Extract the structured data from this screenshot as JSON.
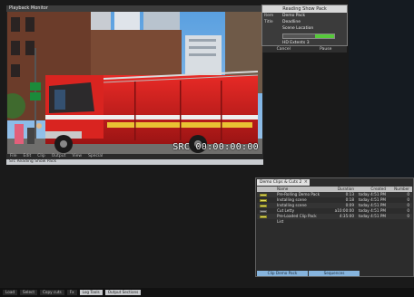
{
  "viewer": {
    "title": "Playback Monitor",
    "timecode": "SRC 00:00:00:00",
    "menu": [
      "File",
      "Edit",
      "Clip",
      "Output",
      "View",
      "Special"
    ],
    "status": "Src Reading Show Pack"
  },
  "pack_panel": {
    "title": "Reading Show Pack",
    "rows": [
      {
        "key": "Item",
        "value": "Demo Pack"
      },
      {
        "key": "Title",
        "value": "Deadline"
      },
      {
        "key": "",
        "value": "Scene Location"
      }
    ],
    "progress": 0.38,
    "file_label": "HD Extents 3",
    "footer": [
      "Cancel",
      "Pause"
    ]
  },
  "bin": {
    "tab_title": "Demo Clips & Cuts 2",
    "columns": [
      "Name",
      "Duration",
      "Created",
      "Number"
    ],
    "rows": [
      {
        "icon": "clip",
        "name": "Pre-Rolling Demo Pack",
        "duration": "0:13",
        "created": "today 4:51 PM",
        "number": "0"
      },
      {
        "icon": "clip",
        "name": "Installing scene",
        "duration": "0:18",
        "created": "today 4:51 PM",
        "number": "0"
      },
      {
        "icon": "clip",
        "name": "Installing scene",
        "duration": "0:09",
        "created": "today 4:51 PM",
        "number": "0"
      },
      {
        "icon": "seq",
        "name": "Cut Letty",
        "duration": "a10:00:00",
        "created": "today 4:51 PM",
        "number": "0"
      },
      {
        "icon": "clip",
        "name": "Pre-Loaded Clip Pack List",
        "duration": "4:35:00",
        "created": "today 4:51 PM",
        "number": "0"
      }
    ],
    "bottom_tabs": [
      "Clip Demo Pack",
      "Sequences"
    ]
  },
  "status_bar": {
    "items": [
      "Load",
      "Select",
      "Copy cuts",
      "Fx",
      "Log Tools",
      "Output Sections"
    ]
  },
  "colors": {
    "progress": "#56c93a",
    "bin_tab_active": "#86b4dd",
    "fire_truck": "#d41f1f"
  }
}
